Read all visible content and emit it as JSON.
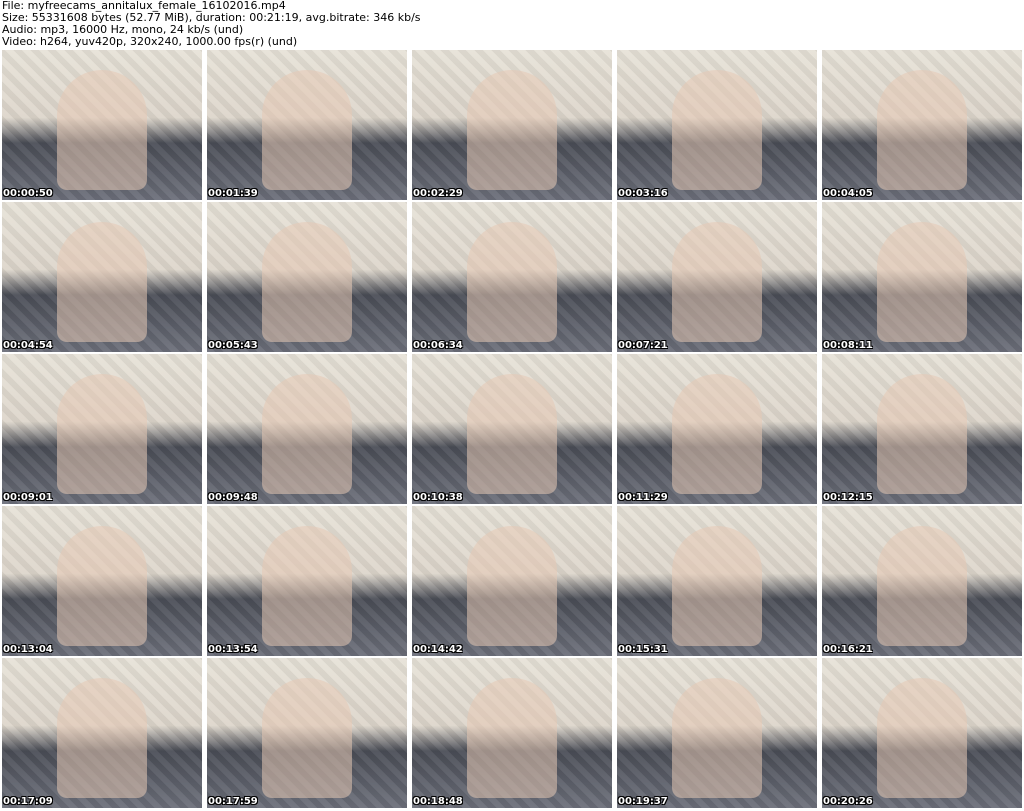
{
  "header": {
    "file": "File: myfreecams_annitalux_female_16102016.mp4",
    "size": "Size: 55331608 bytes (52.77 MiB), duration: 00:21:19, avg.bitrate: 346 kb/s",
    "audio": "Audio: mp3, 16000 Hz, mono, 24 kb/s (und)",
    "video": "Video: h264, yuv420p, 320x240, 1000.00 fps(r) (und)"
  },
  "thumbnails": [
    "00:00:50",
    "00:01:39",
    "00:02:29",
    "00:03:16",
    "00:04:05",
    "00:04:54",
    "00:05:43",
    "00:06:34",
    "00:07:21",
    "00:08:11",
    "00:09:01",
    "00:09:48",
    "00:10:38",
    "00:11:29",
    "00:12:15",
    "00:13:04",
    "00:13:54",
    "00:14:42",
    "00:15:31",
    "00:16:21",
    "00:17:09",
    "00:17:59",
    "00:18:48",
    "00:19:37",
    "00:20:26"
  ]
}
